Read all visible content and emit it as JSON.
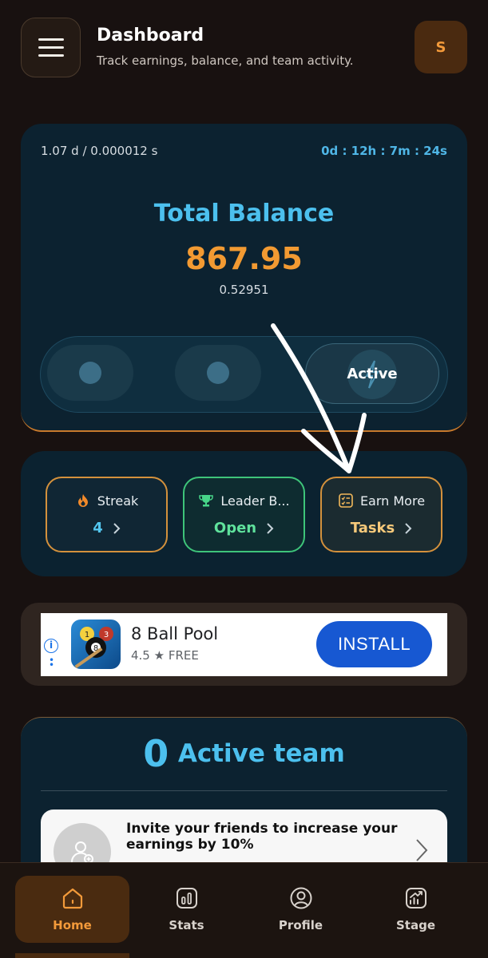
{
  "header": {
    "title": "Dashboard",
    "subtitle": "Track earnings, balance, and team activity.",
    "avatar_initial": "S"
  },
  "balance": {
    "rate": "1.07 d / 0.000012 s",
    "timer": "0d : 12h : 7m : 24s",
    "label": "Total Balance",
    "value": "867.95",
    "sub_value": "0.52951",
    "toggle_active_label": "Active"
  },
  "actions": [
    {
      "label": "Streak",
      "value": "4",
      "icon": "flame-icon"
    },
    {
      "label": "Leader B...",
      "value": "Open",
      "icon": "trophy-icon"
    },
    {
      "label": "Earn More",
      "value": "Tasks",
      "icon": "checklist-icon"
    }
  ],
  "ad": {
    "app_name": "8 Ball Pool",
    "rating": "4.5",
    "price": "FREE",
    "install_label": "INSTALL"
  },
  "team": {
    "count": "0",
    "label": "Active team",
    "invite_text": "Invite your friends to increase your earnings by 10%"
  },
  "nav": [
    {
      "label": "Home",
      "icon": "home-icon",
      "active": true
    },
    {
      "label": "Stats",
      "icon": "stats-icon",
      "active": false
    },
    {
      "label": "Profile",
      "icon": "profile-icon",
      "active": false
    },
    {
      "label": "Stage",
      "icon": "stage-icon",
      "active": false
    }
  ],
  "colors": {
    "accent_orange": "#f29a32",
    "accent_blue": "#4cc0ee",
    "accent_green": "#5fe29c",
    "background": "#181110",
    "card": "#0c2230"
  }
}
